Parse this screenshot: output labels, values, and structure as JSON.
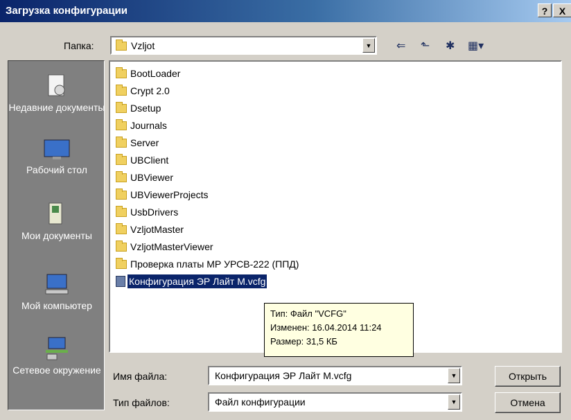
{
  "window": {
    "title": "Загрузка конфигурации",
    "help_label": "?",
    "close_label": "X"
  },
  "lookin": {
    "label": "Папка:",
    "value": "Vzljot"
  },
  "toolbar": {
    "back_glyph": "⇐",
    "up_glyph": "⬑",
    "newfolder_glyph": "✱",
    "views_glyph": "▦▾"
  },
  "places": [
    {
      "label": "Недавние документы",
      "icon": "recent-documents-icon"
    },
    {
      "label": "Рабочий стол",
      "icon": "desktop-icon"
    },
    {
      "label": "Мои документы",
      "icon": "my-documents-icon"
    },
    {
      "label": "Мой компьютер",
      "icon": "my-computer-icon"
    },
    {
      "label": "Сетевое окружение",
      "icon": "network-icon"
    }
  ],
  "files": [
    {
      "name": "BootLoader",
      "type": "folder"
    },
    {
      "name": "Crypt 2.0",
      "type": "folder"
    },
    {
      "name": "Dsetup",
      "type": "folder"
    },
    {
      "name": "Journals",
      "type": "folder"
    },
    {
      "name": "Server",
      "type": "folder"
    },
    {
      "name": "UBClient",
      "type": "folder"
    },
    {
      "name": "UBViewer",
      "type": "folder"
    },
    {
      "name": "UBViewerProjects",
      "type": "folder"
    },
    {
      "name": "UsbDrivers",
      "type": "folder"
    },
    {
      "name": "VzljotMaster",
      "type": "folder"
    },
    {
      "name": "VzljotMasterViewer",
      "type": "folder"
    },
    {
      "name": "Проверка платы МР УРСВ-222 (ППД)",
      "type": "folder"
    },
    {
      "name": "Конфигурация ЭР Лайт М.vcfg",
      "type": "file",
      "selected": true
    }
  ],
  "tooltip": {
    "type_line": "Тип: Файл \"VCFG\"",
    "modified_line": "Изменен: 16.04.2014 11:24",
    "size_line": "Размер: 31,5 КБ"
  },
  "filename": {
    "label": "Имя файла:",
    "value": "Конфигурация ЭР Лайт М.vcfg"
  },
  "filetype": {
    "label": "Тип файлов:",
    "value": "Файл конфигурации"
  },
  "buttons": {
    "open": "Открыть",
    "cancel": "Отмена"
  },
  "colors": {
    "title_start": "#0a246a",
    "selection": "#0a246a",
    "places_bg": "#808080",
    "tooltip_bg": "#ffffe1"
  }
}
